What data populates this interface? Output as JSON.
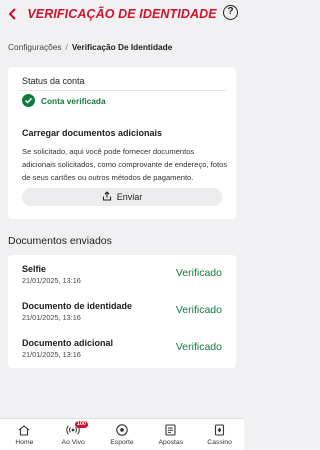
{
  "header": {
    "title": "VERIFICAÇÃO DE IDENTIDADE",
    "help_label": "?"
  },
  "breadcrumb": {
    "parent": "Configurações",
    "separator": "/",
    "current": "Verificação De Identidade"
  },
  "status_card": {
    "label": "Status da conta",
    "verified_text": "Conta verificada",
    "upload_title": "Carregar documentos adicionais",
    "upload_description": "Se solicitado, aqui você pode fornecer documentos adicionais solicitados, como comprovante de endereço, fotos de seus cartões ou outros métodos de pagamento.",
    "send_label": "Enviar"
  },
  "documents": {
    "section_title": "Documentos enviados",
    "items": [
      {
        "name": "Selfie",
        "date": "21/01/2025, 13:16",
        "status": "Verificado"
      },
      {
        "name": "Documento de identidade",
        "date": "21/01/2025, 13:16",
        "status": "Verificado"
      },
      {
        "name": "Documento adicional",
        "date": "21/01/2025, 13:16",
        "status": "Verificado"
      }
    ]
  },
  "nav": {
    "items": [
      {
        "label": "Home",
        "icon": "home-icon"
      },
      {
        "label": "Ao Vivo",
        "icon": "live-icon",
        "badge": "100"
      },
      {
        "label": "Esporte",
        "icon": "soccer-ball-icon"
      },
      {
        "label": "Apostas",
        "icon": "bets-icon"
      },
      {
        "label": "Cassino",
        "icon": "casino-icon"
      }
    ]
  },
  "colors": {
    "brand_red": "#d3122a",
    "success_green": "#127a3c",
    "background": "#f1f1f3"
  }
}
